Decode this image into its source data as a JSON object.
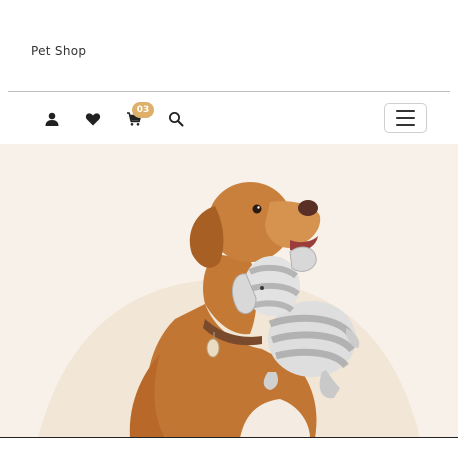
{
  "header": {
    "brand": "Pet Shop"
  },
  "navbar": {
    "icons": [
      "user-icon",
      "heart-icon",
      "cart-icon",
      "search-icon"
    ],
    "cart_count": "03",
    "menu_icon": "hamburger-icon"
  },
  "colors": {
    "hero_bg": "#f8f1ea",
    "hero_arc": "#f2e6d6",
    "badge_bg": "#deb06a",
    "icon": "#222222",
    "dog_fur": "#c47a35",
    "toy": "#d6d6d6"
  }
}
